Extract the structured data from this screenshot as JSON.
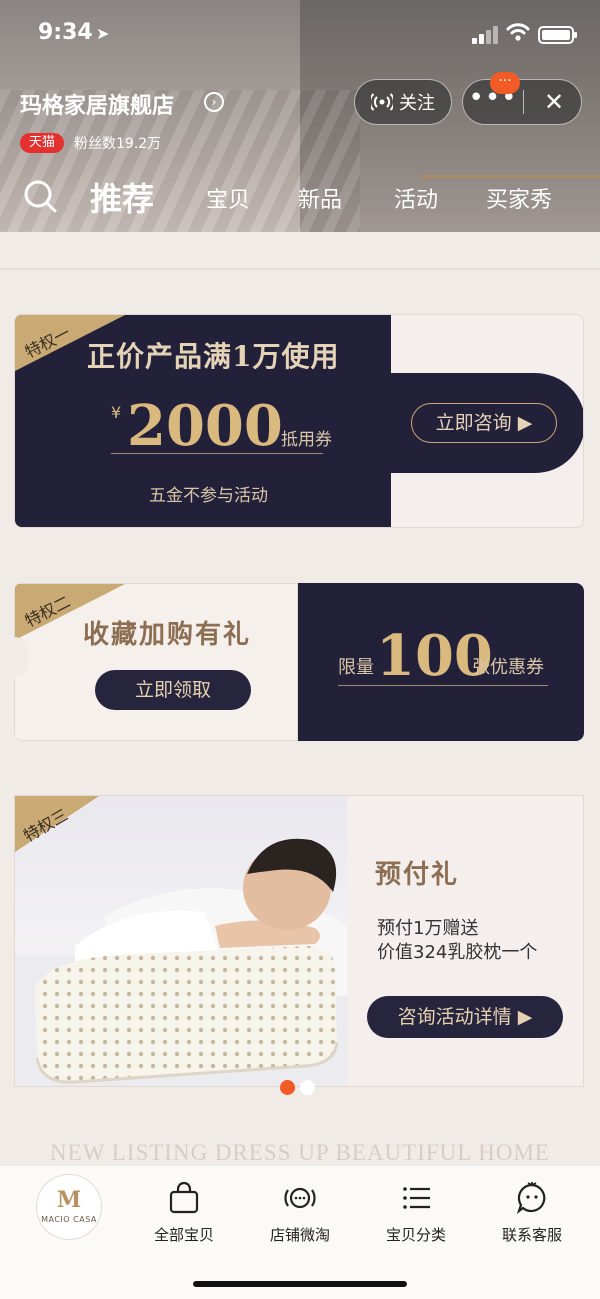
{
  "status_bar": {
    "time": "9:34"
  },
  "store": {
    "name": "玛格家居旗舰店",
    "badge": "天猫",
    "fans": "粉丝数19.2万",
    "follow_label": "关注",
    "more_badge": "···"
  },
  "tabs": [
    {
      "label": "推荐",
      "active": true
    },
    {
      "label": "宝贝"
    },
    {
      "label": "新品"
    },
    {
      "label": "活动"
    },
    {
      "label": "买家秀"
    }
  ],
  "privilege1": {
    "tag": "特权一",
    "title": "正价产品满1万使用",
    "currency": "¥",
    "amount": "2000",
    "unit": "抵用券",
    "note": "五金不参与活动",
    "button": "立即咨询 ▶"
  },
  "privilege2": {
    "tag": "特权二",
    "title": "收藏加购有礼",
    "button": "立即领取",
    "limit": "限量",
    "amount": "100",
    "coupon": "张优惠券"
  },
  "privilege3": {
    "tag": "特权三",
    "title": "预付礼",
    "line1": "预付1万赠送",
    "line2": "价值324乳胶枕一个",
    "button": "咨询活动详情 ▶"
  },
  "carousel": {
    "count": 2,
    "active_index": 0
  },
  "banner_text": "NEW LISTING  DRESS UP  BEAUTIFUL HOME",
  "bottom_nav": {
    "logo_mark": "M",
    "logo_text": "MACIO CASA",
    "items": [
      {
        "label": "全部宝贝",
        "icon": "shopping-bag-icon"
      },
      {
        "label": "店铺微淘",
        "icon": "broadcast-chat-icon"
      },
      {
        "label": "宝贝分类",
        "icon": "list-icon"
      },
      {
        "label": "联系客服",
        "icon": "service-chat-icon"
      }
    ]
  },
  "colors": {
    "accent_orange": "#f25a26",
    "tmall_red": "#e53030",
    "navy": "#23203a",
    "gold": "#d9b97d"
  }
}
